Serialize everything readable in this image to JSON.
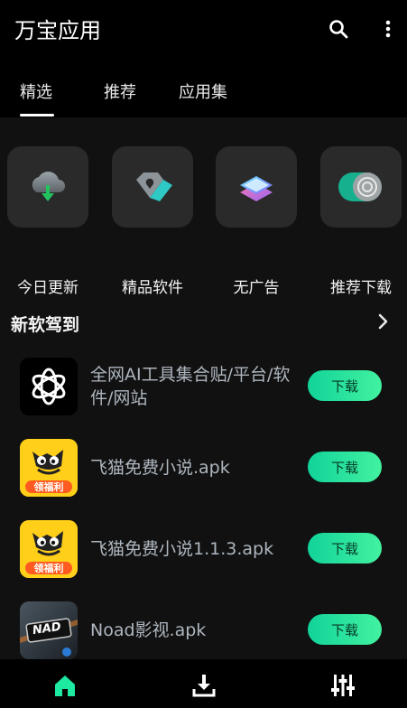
{
  "app": {
    "title": "万宝应用"
  },
  "tabs": [
    {
      "label": "精选",
      "active": true
    },
    {
      "label": "推荐",
      "active": false
    },
    {
      "label": "应用集",
      "active": false
    }
  ],
  "categories": [
    {
      "label": "今日更新",
      "icon": "cloud-download-icon"
    },
    {
      "label": "精品软件",
      "icon": "diamond-icon"
    },
    {
      "label": "无广告",
      "icon": "layers-icon"
    },
    {
      "label": "推荐下载",
      "icon": "toggle-icon"
    }
  ],
  "section": {
    "title": "新软驾到"
  },
  "apps": [
    {
      "name": "全网AI工具集合贴/平台/软件/网站",
      "icon": "openai-icon",
      "button": "下载"
    },
    {
      "name": "飞猫免费小说.apk",
      "icon": "feimao-icon",
      "badge": "领福利",
      "button": "下载"
    },
    {
      "name": "飞猫免费小说1.1.3.apk",
      "icon": "feimao-icon",
      "badge": "领福利",
      "button": "下载"
    },
    {
      "name": "Noad影视.apk",
      "icon": "noad-icon",
      "badge": "NAD",
      "button": "下载"
    }
  ],
  "colors": {
    "accent": "#1de9a0",
    "background": "#000000",
    "panel": "#111111",
    "tile": "#2a2a2a"
  }
}
